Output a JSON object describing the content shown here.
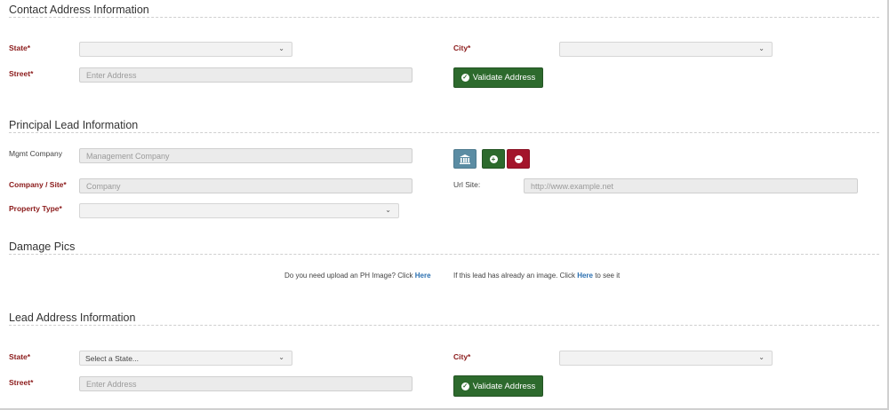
{
  "contact": {
    "title": "Contact Address Information",
    "state_label": "State*",
    "state_value": "",
    "city_label": "City*",
    "city_value": "",
    "street_label": "Street*",
    "street_placeholder": "Enter Address",
    "validate_label": "Validate Address"
  },
  "principal": {
    "title": "Principal Lead Information",
    "mgmt_label": "Mgmt Company",
    "mgmt_placeholder": "Management Company",
    "company_label": "Company / Site*",
    "company_placeholder": "Company",
    "url_label": "Url Site:",
    "url_placeholder": "http://www.example.net",
    "property_label": "Property Type*",
    "property_value": "",
    "buttons": {
      "building_icon": "bank-icon",
      "add_icon": "plus-circle-icon",
      "remove_icon": "minus-circle-icon",
      "colors": {
        "building": "#5b8ca3",
        "add": "#2d6a2d",
        "remove": "#a3152b"
      }
    }
  },
  "damage": {
    "title": "Damage Pics",
    "upload_text": "Do you need upload an PH Image? Click ",
    "upload_link": "Here",
    "view_text_before": "If this lead has already an image. Click ",
    "view_link": "Here",
    "view_text_after": " to see it"
  },
  "lead": {
    "title": "Lead Address Information",
    "state_label": "State*",
    "state_value": "Select a State...",
    "city_label": "City*",
    "city_value": "",
    "street_label": "Street*",
    "street_placeholder": "Enter Address",
    "validate_label": "Validate Address"
  },
  "colors": {
    "required_label": "#8b1a1a",
    "success_button": "#2d6a2d",
    "link": "#2a6fb0"
  }
}
